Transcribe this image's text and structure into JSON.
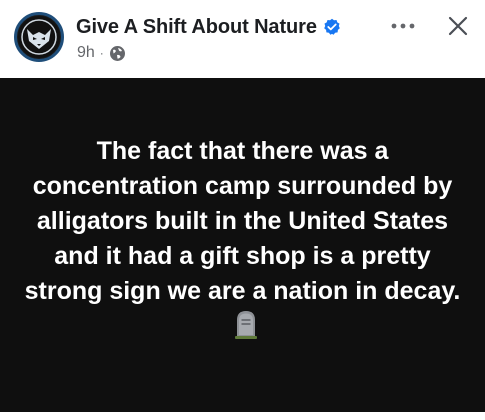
{
  "post": {
    "page_name": "Give A Shift About Nature",
    "timestamp": "9h",
    "separator": "·",
    "audience_icon": "globe-icon",
    "verified_icon": "verified-badge-icon",
    "more_icon": "more-options-icon",
    "close_icon": "close-icon",
    "text": "The fact that there was a concentration camp surrounded by alligators built in the United States and it had a gift shop is a pretty strong sign we are a nation in decay.",
    "emoji": "tombstone-emoji"
  },
  "colors": {
    "background": "#ffffff",
    "post_background": "#0f0f0f",
    "post_text": "#ffffff",
    "name_text": "#1c1e21",
    "meta_text": "#65676b",
    "verified": "#1877f2",
    "avatar_ring": "#1f4e7a"
  }
}
